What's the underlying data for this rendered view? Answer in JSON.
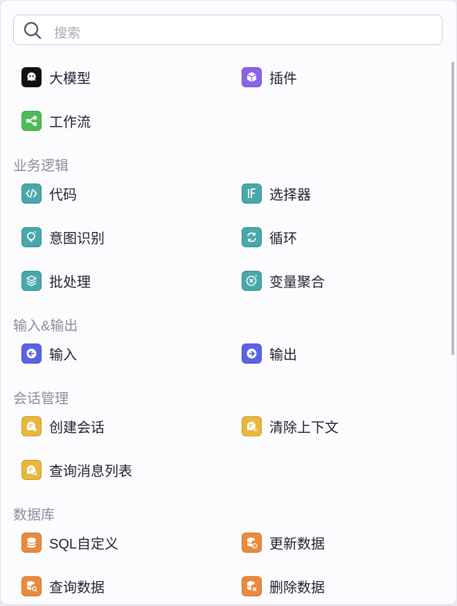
{
  "search": {
    "placeholder": "搜索",
    "icon": "search-icon"
  },
  "top_items": [
    {
      "label": "大模型",
      "icon": "llm-icon",
      "color": "#111111"
    },
    {
      "label": "插件",
      "icon": "plugin-icon",
      "color": "#8a64e6"
    },
    {
      "label": "工作流",
      "icon": "workflow-icon",
      "color": "#4fbb58"
    }
  ],
  "sections": {
    "business_logic": {
      "title": "业务逻辑",
      "items": [
        {
          "label": "代码",
          "icon": "code-icon",
          "color": "#4aa8aa"
        },
        {
          "label": "选择器",
          "icon": "if-selector-icon",
          "color": "#4aa8aa"
        },
        {
          "label": "意图识别",
          "icon": "lightbulb-icon",
          "color": "#4aa8aa"
        },
        {
          "label": "循环",
          "icon": "loop-icon",
          "color": "#4aa8aa"
        },
        {
          "label": "批处理",
          "icon": "layers-icon",
          "color": "#4aa8aa"
        },
        {
          "label": "变量聚合",
          "icon": "variable-aggregate-icon",
          "color": "#4aa8aa"
        }
      ]
    },
    "io": {
      "title": "输入&输出",
      "items": [
        {
          "label": "输入",
          "icon": "input-arrow-icon",
          "color": "#5a63e6"
        },
        {
          "label": "输出",
          "icon": "output-arrow-icon",
          "color": "#5a63e6"
        }
      ]
    },
    "conversation": {
      "title": "会话管理",
      "items": [
        {
          "label": "创建会话",
          "icon": "create-conversation-icon",
          "color": "#e9b73c"
        },
        {
          "label": "清除上下文",
          "icon": "clear-context-icon",
          "color": "#e9b73c"
        },
        {
          "label": "查询消息列表",
          "icon": "query-messages-icon",
          "color": "#e9b73c"
        }
      ]
    },
    "database": {
      "title": "数据库",
      "items": [
        {
          "label": "SQL自定义",
          "icon": "database-icon",
          "color": "#ea8a3e"
        },
        {
          "label": "更新数据",
          "icon": "database-update-icon",
          "color": "#ea8a3e"
        },
        {
          "label": "查询数据",
          "icon": "database-query-icon",
          "color": "#ea8a3e"
        },
        {
          "label": "删除数据",
          "icon": "database-delete-icon",
          "color": "#ea8a3e"
        }
      ]
    }
  }
}
